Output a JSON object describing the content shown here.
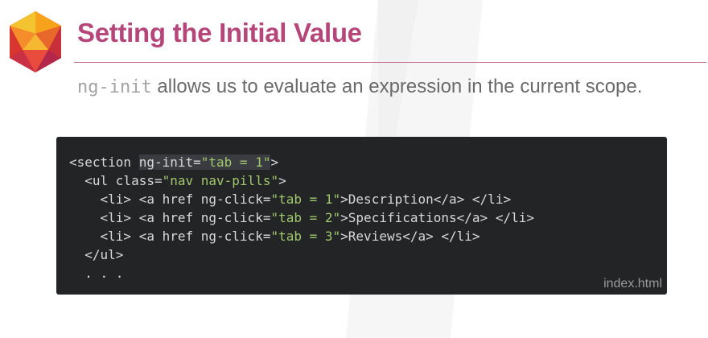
{
  "slide": {
    "title": "Setting the Initial Value",
    "subtitle_code": "ng-init",
    "subtitle_text": " allows us to evaluate an expression in the current scope."
  },
  "code": {
    "filename": "index.html",
    "lines": [
      {
        "indent": "",
        "segments": [
          {
            "t": "plain",
            "v": "<section "
          },
          {
            "t": "plain",
            "v": "ng-init=",
            "hl": true
          },
          {
            "t": "str",
            "v": "\"tab = 1\"",
            "hl": true
          },
          {
            "t": "plain",
            "v": ">"
          }
        ]
      },
      {
        "indent": "  ",
        "segments": [
          {
            "t": "plain",
            "v": "<ul class="
          },
          {
            "t": "str",
            "v": "\"nav nav-pills\""
          },
          {
            "t": "plain",
            "v": ">"
          }
        ]
      },
      {
        "indent": "    ",
        "segments": [
          {
            "t": "plain",
            "v": "<li> <a href ng-click="
          },
          {
            "t": "str",
            "v": "\"tab = 1\""
          },
          {
            "t": "plain",
            "v": ">Description</a> </li>"
          }
        ]
      },
      {
        "indent": "    ",
        "segments": [
          {
            "t": "plain",
            "v": "<li> <a href ng-click="
          },
          {
            "t": "str",
            "v": "\"tab = 2\""
          },
          {
            "t": "plain",
            "v": ">Specifications</a> </li>"
          }
        ]
      },
      {
        "indent": "    ",
        "segments": [
          {
            "t": "plain",
            "v": "<li> <a href ng-click="
          },
          {
            "t": "str",
            "v": "\"tab = 3\""
          },
          {
            "t": "plain",
            "v": ">Reviews</a> </li>"
          }
        ]
      },
      {
        "indent": "  ",
        "segments": [
          {
            "t": "plain",
            "v": "</ul>"
          }
        ]
      },
      {
        "indent": "  ",
        "segments": [
          {
            "t": "plain",
            "v": ". . ."
          }
        ]
      }
    ]
  },
  "colors": {
    "title": "#b6457a",
    "code_background": "#232426",
    "string": "#9fc76b",
    "highlight": "#3a3c41"
  },
  "icons": [
    "gem-logo-icon"
  ]
}
